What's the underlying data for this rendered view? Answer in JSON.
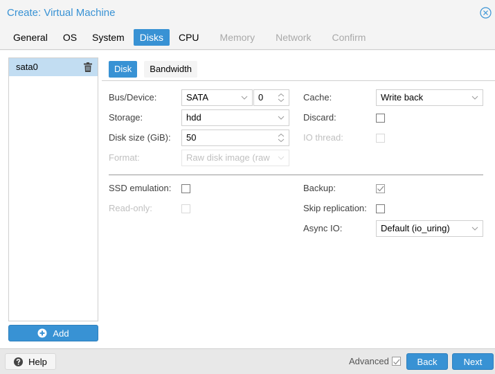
{
  "window": {
    "title": "Create: Virtual Machine",
    "close_icon": "close-circle-icon"
  },
  "tabs": [
    {
      "label": "General",
      "state": "normal"
    },
    {
      "label": "OS",
      "state": "normal"
    },
    {
      "label": "System",
      "state": "normal"
    },
    {
      "label": "Disks",
      "state": "active"
    },
    {
      "label": "CPU",
      "state": "normal"
    },
    {
      "label": "Memory",
      "state": "disabled"
    },
    {
      "label": "Network",
      "state": "disabled"
    },
    {
      "label": "Confirm",
      "state": "disabled"
    }
  ],
  "disk_list": {
    "items": [
      {
        "label": "sata0",
        "selected": true,
        "delete_icon": "trash-icon"
      }
    ],
    "add_button": {
      "label": "Add",
      "icon": "plus-circle-icon"
    }
  },
  "subtabs": [
    {
      "label": "Disk",
      "active": true
    },
    {
      "label": "Bandwidth",
      "active": false
    }
  ],
  "form": {
    "bus_device": {
      "label": "Bus/Device:",
      "bus": "SATA",
      "device": "0"
    },
    "storage": {
      "label": "Storage:",
      "value": "hdd"
    },
    "disk_size": {
      "label": "Disk size (GiB):",
      "value": "50"
    },
    "format": {
      "label": "Format:",
      "value": "Raw disk image (raw",
      "disabled": true
    },
    "cache": {
      "label": "Cache:",
      "value": "Write back"
    },
    "discard": {
      "label": "Discard:",
      "checked": false
    },
    "io_thread": {
      "label": "IO thread:",
      "checked": false,
      "disabled": true
    },
    "ssd_emulation": {
      "label": "SSD emulation:",
      "checked": false
    },
    "read_only": {
      "label": "Read-only:",
      "checked": false,
      "disabled": true
    },
    "backup": {
      "label": "Backup:",
      "checked": true
    },
    "skip_replication": {
      "label": "Skip replication:",
      "checked": false
    },
    "async_io": {
      "label": "Async IO:",
      "value": "Default (io_uring)"
    }
  },
  "footer": {
    "help_label": "Help",
    "help_icon": "question-circle-icon",
    "advanced_label": "Advanced",
    "advanced_checked": true,
    "back_label": "Back",
    "next_label": "Next"
  },
  "colors": {
    "accent": "#3892d4",
    "selection": "#c2ddf2",
    "disabled_text": "#a9a9a9"
  }
}
